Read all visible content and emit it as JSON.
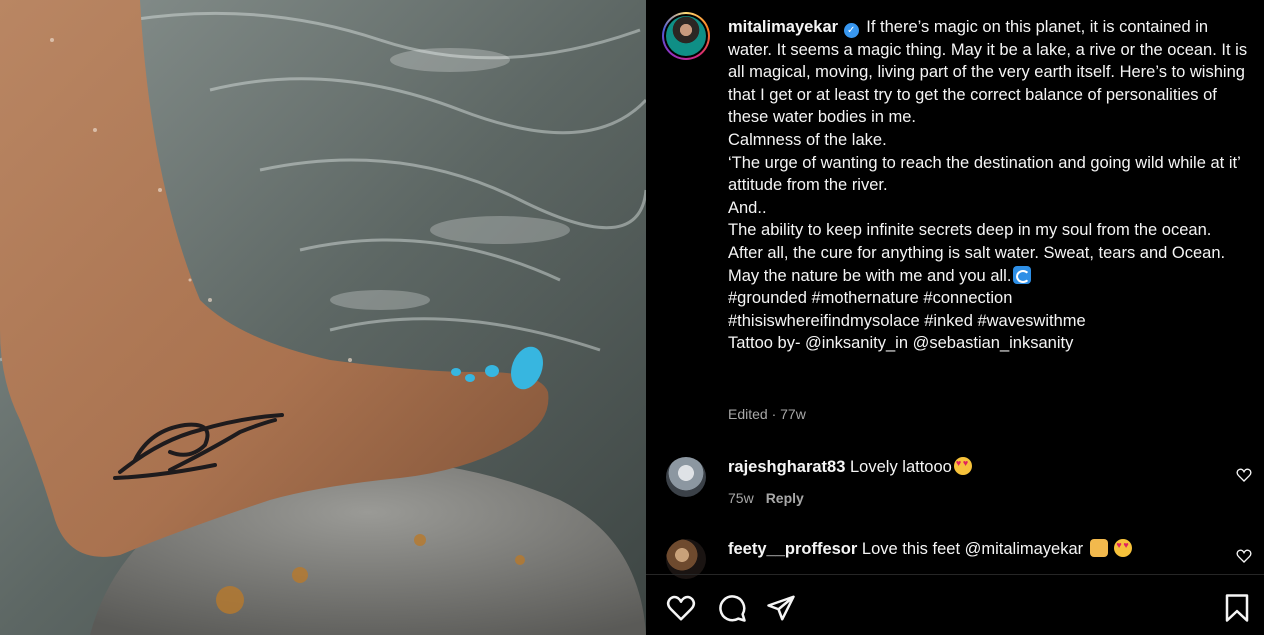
{
  "post": {
    "username": "mitalimayekar",
    "caption_lines": [
      "If there’s magic on this planet, it is contained in water. It seems a magic thing. May it be a lake, a rive or the ocean. It is all magical, moving, living part of the very earth itself. Here’s to wishing that I get or at least try to get the correct balance of personalities of these water bodies in me.",
      "Calmness of the lake.",
      "‘The urge of wanting to reach the destination and going wild while at it’ attitude from the river.",
      "And..",
      "The ability to keep infinite secrets deep in my soul from the ocean.",
      "After all, the cure for anything is salt water. Sweat, tears and Ocean.",
      "May the nature be with me and you all.",
      "#grounded #mothernature #connection",
      "#thisiswhereifindmysolace #inked #waveswithme",
      "Tattoo by- @inksanity_in @sebastian_inksanity"
    ],
    "meta": "Edited · 77w"
  },
  "comments": [
    {
      "username": "rajeshgharat83",
      "text": "Lovely lattooo",
      "time": "75w",
      "reply_label": "Reply"
    },
    {
      "username": "feety__proffesor",
      "text": "Love this feet @mitalimayekar"
    }
  ],
  "icons": {
    "verified": "verified-badge-icon",
    "wave": "water-wave-icon",
    "like": "heart-icon",
    "comment": "comment-icon",
    "share": "share-icon",
    "save": "bookmark-icon"
  },
  "colors": {
    "background": "#000000",
    "text": "#f5f5f5",
    "secondary_text": "#a8a8a8",
    "verified": "#3897f0"
  }
}
